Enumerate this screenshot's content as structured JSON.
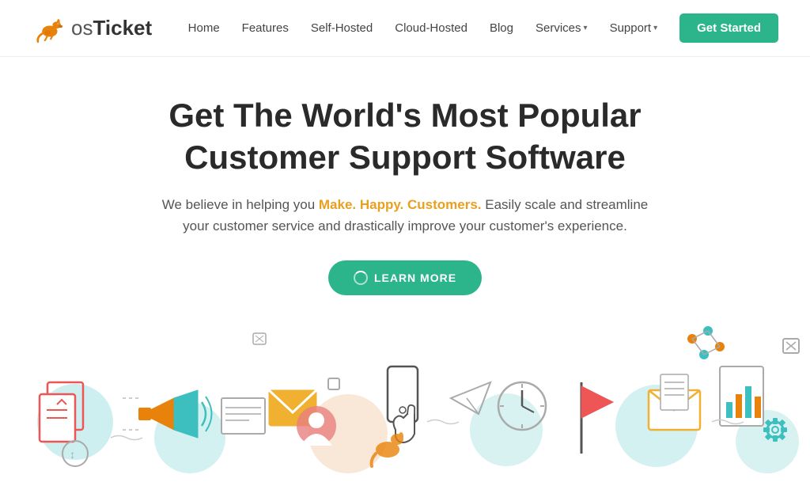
{
  "header": {
    "logo": {
      "os": "os",
      "ticket": "Ticket"
    },
    "nav": {
      "home": "Home",
      "features": "Features",
      "self_hosted": "Self-Hosted",
      "cloud_hosted": "Cloud-Hosted",
      "blog": "Blog",
      "services": "Services",
      "support": "Support",
      "get_started": "Get Started"
    }
  },
  "hero": {
    "title_line1": "Get The World's Most Popular",
    "title_line2": "Customer Support Software",
    "description_before": "We believe in helping you ",
    "highlight": "Make. Happy. Customers.",
    "description_after": " Easily scale and streamline your customer service and drastically improve your customer's experience.",
    "cta_button": "LEARN MORE"
  }
}
